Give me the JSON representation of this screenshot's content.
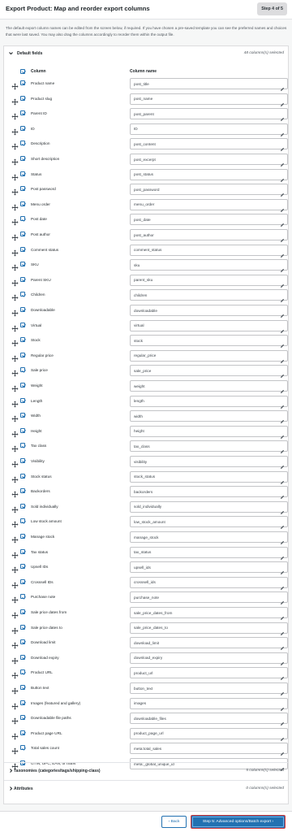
{
  "header": {
    "title": "Export Product: Map and reorder export columns",
    "step": "Step 4 of 5"
  },
  "intro": "The default export column names can be edited from the screen below, if required. If you have chosen a pre-saved template you can see the preferred names and choices that were last saved. You may also drag the columns accordingly to reorder them within the output file.",
  "sections": {
    "default_fields": {
      "label": "Default fields",
      "count": "48 columns(s) selected",
      "icon": "chevron-down-icon"
    },
    "taxonomies": {
      "label": "Taxonomies (categories/tags/shipping-class)",
      "count": "5 columns(s) selected",
      "icon": "chevron-right-icon"
    },
    "attributes": {
      "label": "Attributes",
      "count": "0 columns(s) selected",
      "icon": "chevron-right-icon"
    }
  },
  "table": {
    "column_header": "Column",
    "column_name_header": "Column name"
  },
  "rows": [
    {
      "column": "Product name",
      "name": "post_title"
    },
    {
      "column": "Product slug",
      "name": "post_name"
    },
    {
      "column": "Parent ID",
      "name": "post_parent"
    },
    {
      "column": "ID",
      "name": "ID"
    },
    {
      "column": "Description",
      "name": "post_content"
    },
    {
      "column": "Short description",
      "name": "post_excerpt"
    },
    {
      "column": "Status",
      "name": "post_status"
    },
    {
      "column": "Post password",
      "name": "post_password"
    },
    {
      "column": "Menu order",
      "name": "menu_order"
    },
    {
      "column": "Post date",
      "name": "post_date"
    },
    {
      "column": "Post author",
      "name": "post_author"
    },
    {
      "column": "Comment status",
      "name": "comment_status"
    },
    {
      "column": "SKU",
      "name": "sku"
    },
    {
      "column": "Parent SKU",
      "name": "parent_sku"
    },
    {
      "column": "Children",
      "name": "children"
    },
    {
      "column": "Downloadable",
      "name": "downloadable"
    },
    {
      "column": "Virtual",
      "name": "virtual"
    },
    {
      "column": "Stock",
      "name": "stock"
    },
    {
      "column": "Regular price",
      "name": "regular_price"
    },
    {
      "column": "Sale price",
      "name": "sale_price"
    },
    {
      "column": "Weight",
      "name": "weight"
    },
    {
      "column": "Length",
      "name": "length"
    },
    {
      "column": "Width",
      "name": "width"
    },
    {
      "column": "Height",
      "name": "height"
    },
    {
      "column": "Tax class",
      "name": "tax_class"
    },
    {
      "column": "Visibility",
      "name": "visibility"
    },
    {
      "column": "Stock status",
      "name": "stock_status"
    },
    {
      "column": "Backorders",
      "name": "backorders"
    },
    {
      "column": "Sold individually",
      "name": "sold_individually"
    },
    {
      "column": "Low stock amount",
      "name": "low_stock_amount"
    },
    {
      "column": "Manage stock",
      "name": "manage_stock"
    },
    {
      "column": "Tax status",
      "name": "tax_status"
    },
    {
      "column": "Upsell IDs",
      "name": "upsell_ids"
    },
    {
      "column": "Crosssell IDs",
      "name": "crosssell_ids"
    },
    {
      "column": "Purchase note",
      "name": "purchase_note"
    },
    {
      "column": "Sale price dates from",
      "name": "sale_price_dates_from"
    },
    {
      "column": "Sale price dates to",
      "name": "sale_price_dates_to"
    },
    {
      "column": "Download limit",
      "name": "download_limit"
    },
    {
      "column": "Download expiry",
      "name": "download_expiry"
    },
    {
      "column": "Product URL",
      "name": "product_url"
    },
    {
      "column": "Button text",
      "name": "button_text"
    },
    {
      "column": "Images (featured and gallery)",
      "name": "images"
    },
    {
      "column": "Downloadable file paths",
      "name": "downloadable_files"
    },
    {
      "column": "Product page URL",
      "name": "product_page_url"
    },
    {
      "column": "Total sales count",
      "name": "meta:total_sales"
    },
    {
      "column": "GTIN, UPC, EAN, or ISBN",
      "name": "meta:_global_unique_id"
    }
  ],
  "footer": {
    "back_label": "Back",
    "next_label": "Step 5: Advanced options/Batch export"
  },
  "colors": {
    "accent": "#2271b1",
    "focus_ring": "#d63638"
  }
}
